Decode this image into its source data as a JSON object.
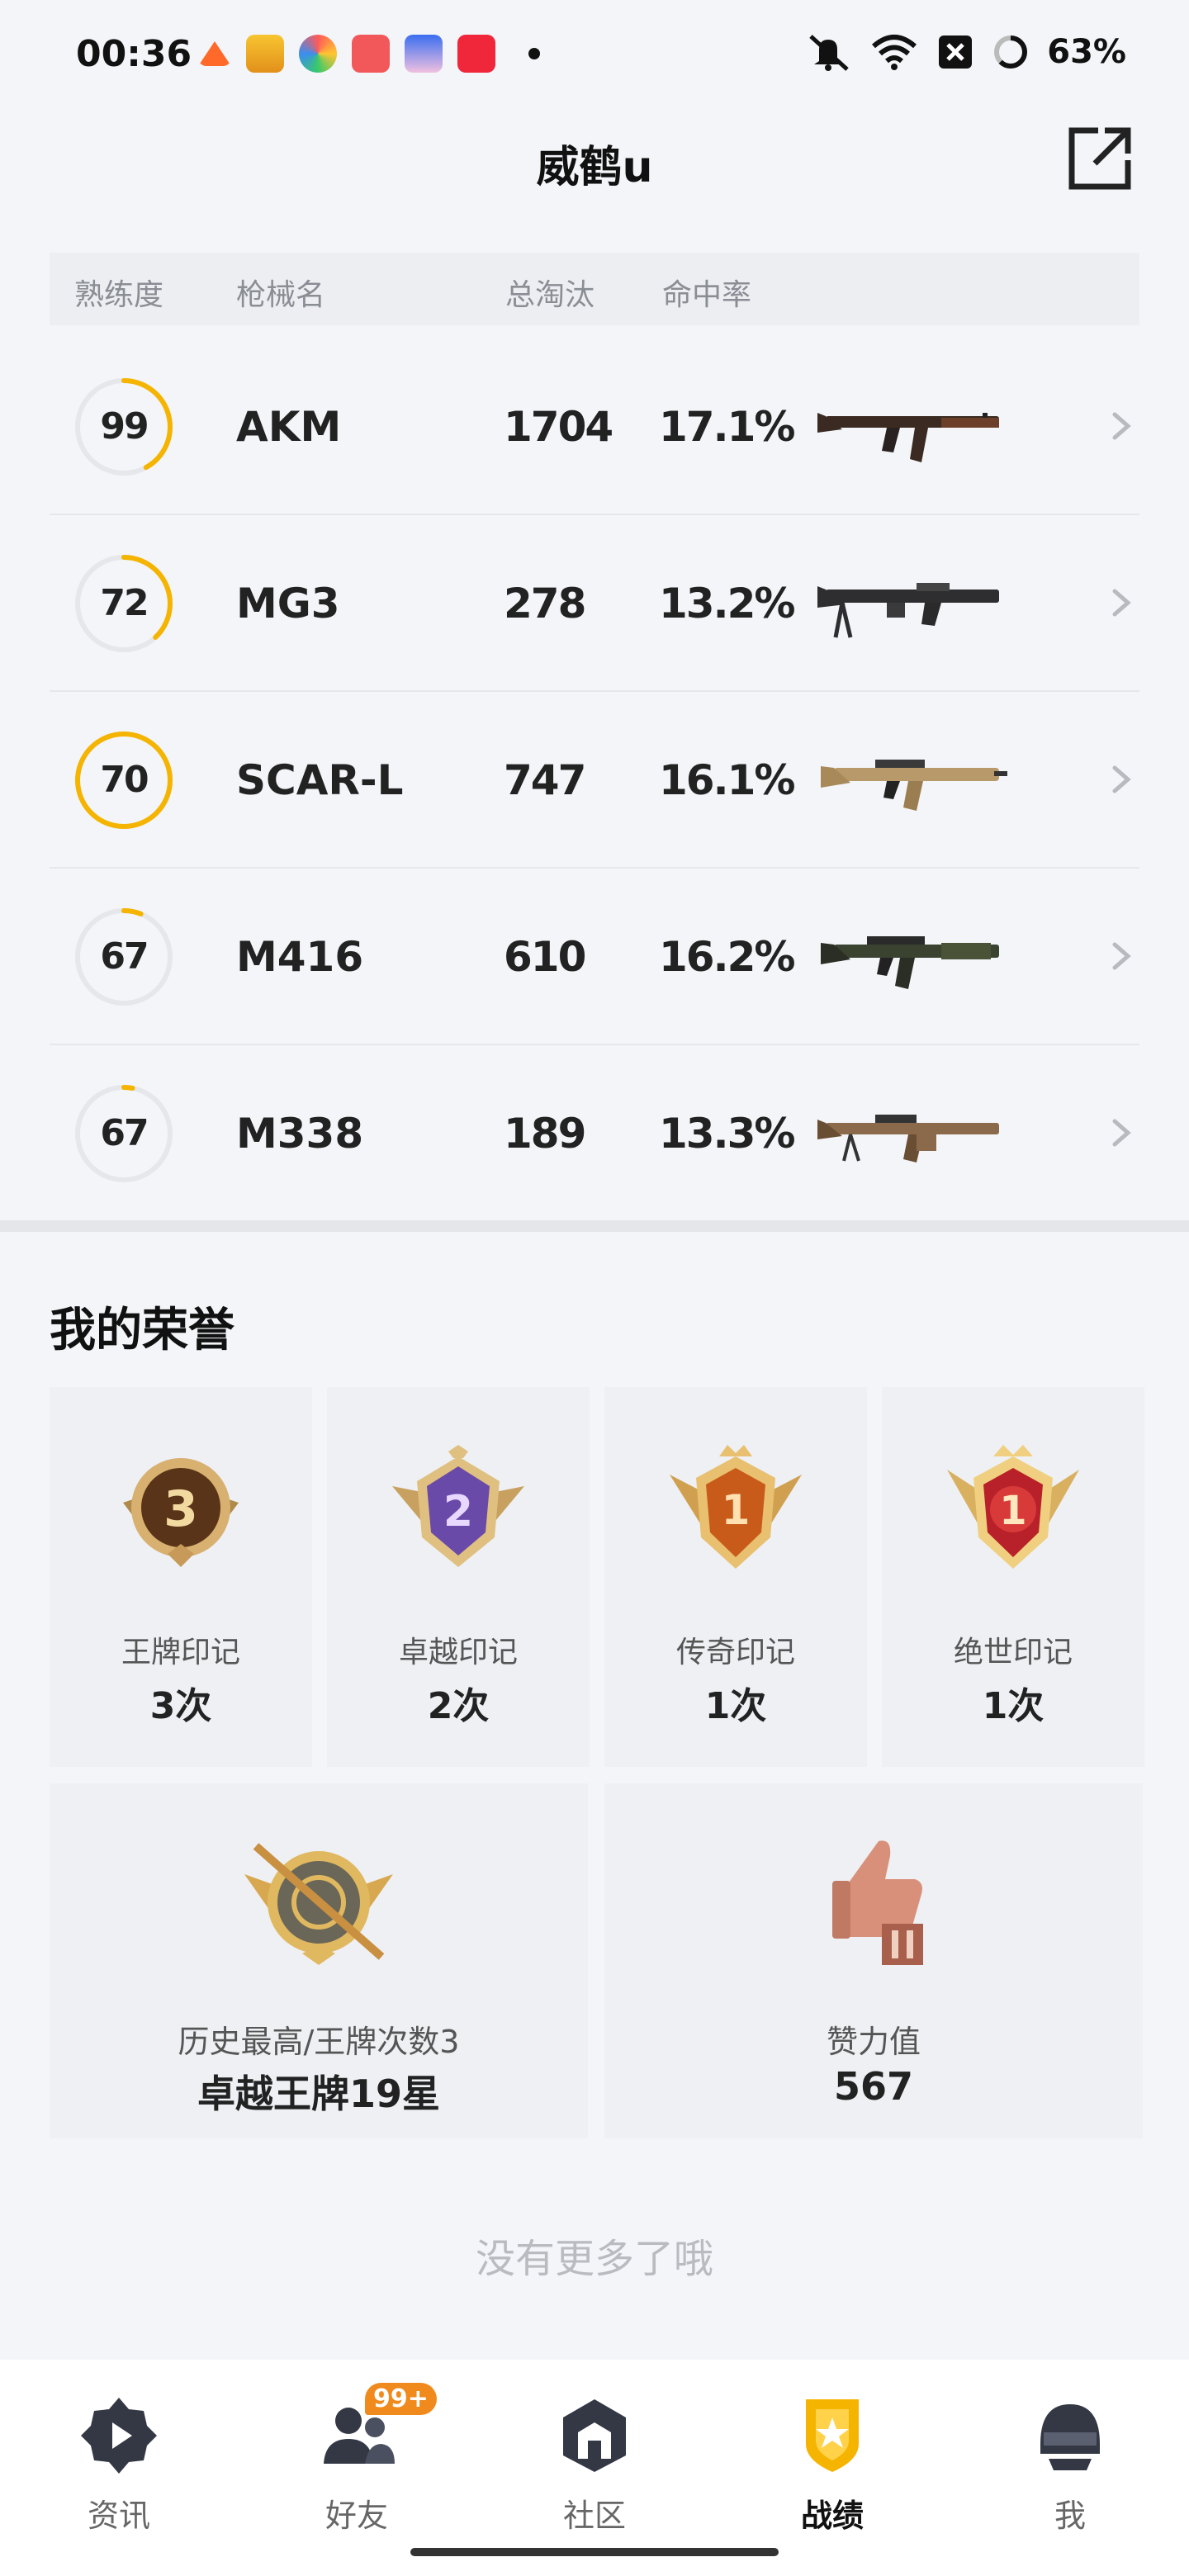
{
  "status_bar": {
    "time": "00:36",
    "battery": "63%",
    "icons": [
      "mute-icon",
      "wifi-icon",
      "sim-off-icon",
      "battery-ring-icon"
    ]
  },
  "header": {
    "title": "威鹤u",
    "share_icon": "share-export-icon"
  },
  "table": {
    "columns": {
      "proficiency": "熟练度",
      "gun_name": "枪械名",
      "kills": "总淘汰",
      "hit_rate": "命中率"
    },
    "rows": [
      {
        "proficiency": "99",
        "ring_fraction": 0.42,
        "name": "AKM",
        "kills": "1704",
        "hit_rate": "17.1%",
        "gun_color": "#6b3f2a"
      },
      {
        "proficiency": "72",
        "ring_fraction": 0.38,
        "name": "MG3",
        "kills": "278",
        "hit_rate": "13.2%",
        "gun_color": "#2e2e30"
      },
      {
        "proficiency": "70",
        "ring_fraction": 1.0,
        "name": "SCAR-L",
        "kills": "747",
        "hit_rate": "16.1%",
        "gun_color": "#b89a6a"
      },
      {
        "proficiency": "67",
        "ring_fraction": 0.06,
        "name": "M416",
        "kills": "610",
        "hit_rate": "16.2%",
        "gun_color": "#3a4230"
      },
      {
        "proficiency": "67",
        "ring_fraction": 0.03,
        "name": "M338",
        "kills": "189",
        "hit_rate": "13.3%",
        "gun_color": "#8a6a4a"
      }
    ]
  },
  "honors": {
    "title": "我的荣誉",
    "items": [
      {
        "name": "王牌印记",
        "count": "3次",
        "badge_number": "3",
        "color": "#8a5a2a"
      },
      {
        "name": "卓越印记",
        "count": "2次",
        "badge_number": "2",
        "color": "#6a4aa8"
      },
      {
        "name": "传奇印记",
        "count": "1次",
        "badge_number": "1",
        "color": "#c85a1a"
      },
      {
        "name": "绝世印记",
        "count": "1次",
        "badge_number": "1",
        "color": "#b8202a"
      }
    ],
    "best": {
      "label": "历史最高/王牌次数3",
      "value": "卓越王牌19星"
    },
    "likes": {
      "label": "赞力值",
      "value": "567"
    }
  },
  "footer": {
    "no_more": "没有更多了哦"
  },
  "bottom_nav": {
    "active": "战绩",
    "items": [
      {
        "label": "资讯",
        "icon": "news-play-icon"
      },
      {
        "label": "好友",
        "icon": "friends-icon",
        "badge": "99+"
      },
      {
        "label": "社区",
        "icon": "community-icon"
      },
      {
        "label": "战绩",
        "icon": "record-shield-icon"
      },
      {
        "label": "我",
        "icon": "helmet-icon"
      }
    ]
  },
  "colors": {
    "accent": "#f5b400",
    "ring_track": "#e6e7eb",
    "badge_orange": "#f08a1c"
  }
}
